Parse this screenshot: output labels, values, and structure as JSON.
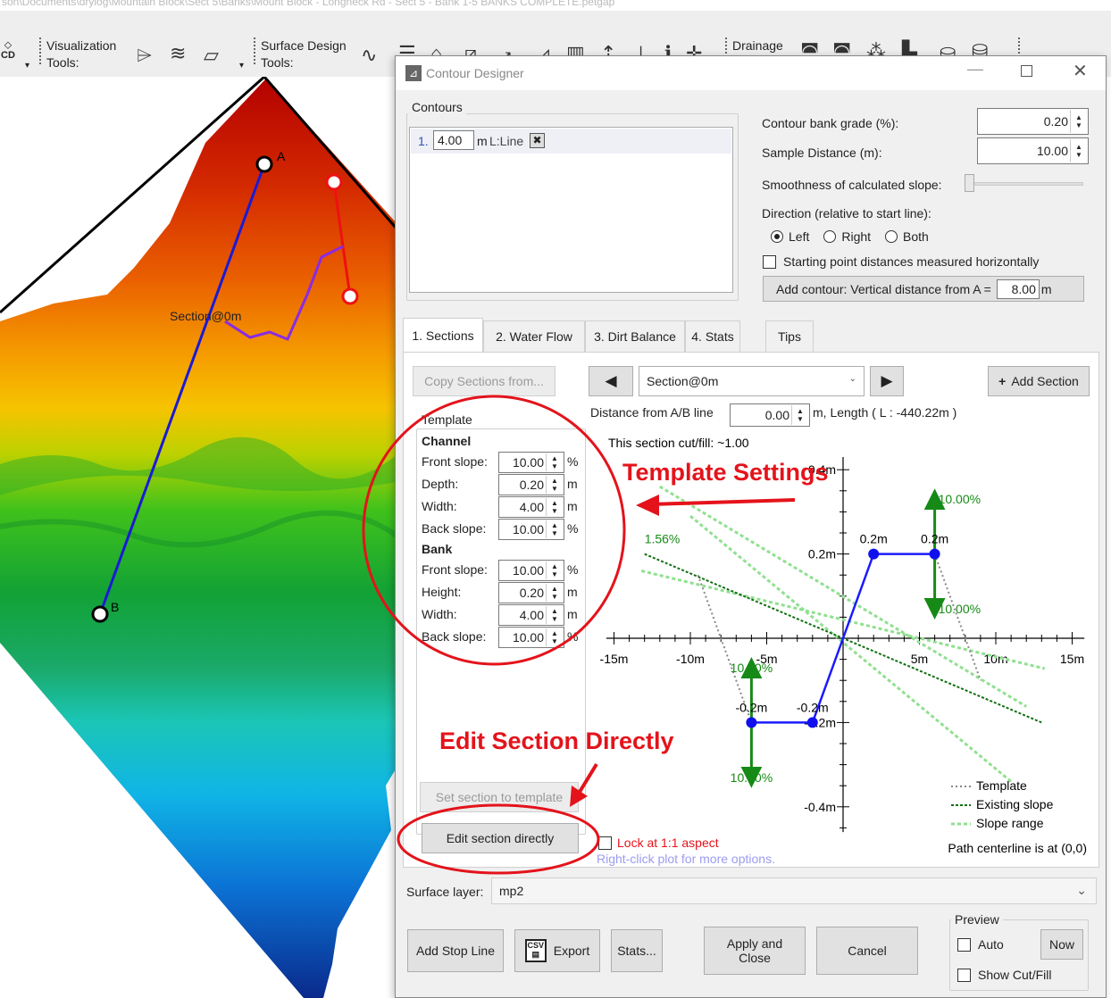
{
  "window": {
    "path": "son\\Documents\\drylog\\Mountain Block\\Sect 5\\Banks\\Mount Block - Longneck Rd - Sect 5 - Bank 1-5 BANKS COMPLETE.petgap"
  },
  "toolbar": {
    "cd_label": "CD",
    "visualization_label": "Visualization",
    "visualization_tools": "Tools:",
    "surface_label": "Surface Design",
    "surface_tools": "Tools:",
    "drainage_label": "Drainage"
  },
  "map": {
    "point_a": "A",
    "point_b": "B",
    "section_label": "Section@0m"
  },
  "dialog": {
    "title": "Contour Designer",
    "contours_title": "Contours",
    "contour_index": "1.",
    "contour_value": "4.00",
    "contour_unit": "m",
    "contour_type": "L:Line",
    "bank_grade_label": "Contour bank grade (%):",
    "bank_grade_value": "0.20",
    "sample_distance_label": "Sample Distance (m):",
    "sample_distance_value": "10.00",
    "smoothness_label": "Smoothness of calculated slope:",
    "direction_label": "Direction (relative to start line):",
    "direction_options": [
      "Left",
      "Right",
      "Both"
    ],
    "horizontal_label": "Starting point distances measured horizontally",
    "add_contour_label": "Add contour: Vertical distance from A =",
    "add_contour_value": "8.00",
    "add_contour_unit": "m",
    "tabs": [
      "1. Sections",
      "2. Water Flow",
      "3. Dirt Balance",
      "4. Stats",
      "Tips"
    ],
    "copy_sections": "Copy Sections from...",
    "prev_symbol": "◀",
    "next_symbol": "▶",
    "section_select": "Section@0m",
    "add_section": "Add Section",
    "distance_label": "Distance from A/B line",
    "distance_value": "0.00",
    "length_label": "m, Length ( L : -440.22m )",
    "template_title": "Template",
    "channel_label": "Channel",
    "bank_label": "Bank",
    "channel_fields": [
      {
        "label": "Front slope:",
        "value": "10.00",
        "unit": "%"
      },
      {
        "label": "Depth:",
        "value": "0.20",
        "unit": "m"
      },
      {
        "label": "Width:",
        "value": "4.00",
        "unit": "m"
      },
      {
        "label": "Back slope:",
        "value": "10.00",
        "unit": "%"
      }
    ],
    "bank_fields": [
      {
        "label": "Front slope:",
        "value": "10.00",
        "unit": "%"
      },
      {
        "label": "Height:",
        "value": "0.20",
        "unit": "m"
      },
      {
        "label": "Width:",
        "value": "4.00",
        "unit": "m"
      },
      {
        "label": "Back slope:",
        "value": "10.00",
        "unit": "%"
      }
    ],
    "set_section": "Set section to template",
    "edit_section": "Edit section directly",
    "lock_aspect": "Lock at 1:1 aspect",
    "right_click_hint": "Right-click plot for more options.",
    "surface_layer_label": "Surface layer:",
    "surface_layer_value": "mp2",
    "add_stop_line": "Add Stop Line",
    "export": "Export",
    "stats": "Stats...",
    "apply_close_1": "Apply and",
    "apply_close_2": "Close",
    "cancel": "Cancel",
    "preview_title": "Preview",
    "auto": "Auto",
    "now": "Now",
    "show_cutfill": "Show Cut/Fill"
  },
  "annotations": {
    "template_settings": "Template Settings",
    "edit_section_directly": "Edit Section Directly"
  },
  "chart_data": {
    "type": "line",
    "subtitle": "This section cut/fill: ~1.00",
    "x_ticks": [
      "-15m",
      "-10m",
      "-5m",
      "5m",
      "10m",
      "15m"
    ],
    "y_ticks": [
      "0.4m",
      "0.2m",
      "-0.2m",
      "-0.4m"
    ],
    "xlim": [
      -15,
      15
    ],
    "ylim": [
      -0.45,
      0.45
    ],
    "template_section": [
      {
        "x": -6,
        "y": -0.2
      },
      {
        "x": -2,
        "y": -0.2
      },
      {
        "x": 0,
        "y": 0
      },
      {
        "x": 2,
        "y": 0.2
      },
      {
        "x": 6,
        "y": 0.2
      }
    ],
    "point_labels": [
      {
        "text": "-0.2m",
        "x": -6,
        "y": -0.2
      },
      {
        "text": "-0.2m",
        "x": -2,
        "y": -0.2
      },
      {
        "text": "0.2m",
        "x": 2,
        "y": 0.2
      },
      {
        "text": "0.2m",
        "x": 6,
        "y": 0.2
      }
    ],
    "slope_labels": [
      {
        "text": "10.00%",
        "x": 6,
        "y": 0.33
      },
      {
        "text": "10.00%",
        "x": 6,
        "y": 0.07
      },
      {
        "text": "10.00%",
        "x": -6,
        "y": -0.07
      },
      {
        "text": "10.00%",
        "x": -6,
        "y": -0.33
      }
    ],
    "existing_slope_label": "1.56%",
    "existing_slope_pct": 1.56,
    "legend": [
      "Template",
      "Existing slope",
      "Slope range"
    ],
    "footer": "Path centerline is at (0,0)",
    "colors": {
      "template": "#1a1aff",
      "existing": "#107010",
      "range": "#90e090",
      "arrows": "#168a16",
      "points": "#1010ee"
    }
  }
}
